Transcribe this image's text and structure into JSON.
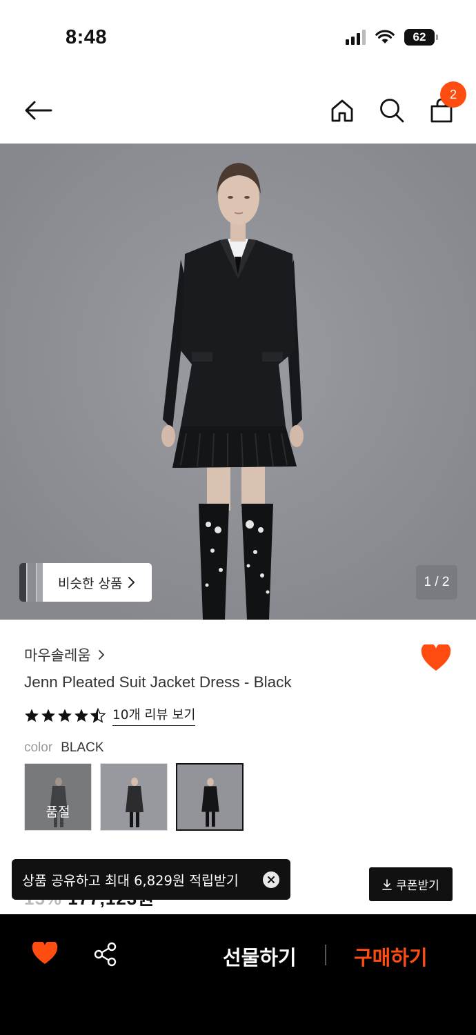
{
  "status_bar": {
    "time": "8:48",
    "battery": "62"
  },
  "nav": {
    "cart_count": "2"
  },
  "gallery": {
    "similar_label": "비슷한 상품",
    "page_indicator": "1 / 2"
  },
  "product": {
    "brand": "마우솔레움",
    "title": "Jenn Pleated Suit Jacket Dress - Black",
    "rating": 4.5,
    "review_link": "10개 리뷰 보기",
    "color_label": "color",
    "color_value": "BLACK",
    "swatches": [
      {
        "status": "품절"
      },
      {
        "status": ""
      },
      {
        "status": ""
      }
    ]
  },
  "price_peek": {
    "discount": "15%",
    "price": "177,123원"
  },
  "toast": {
    "message": "상품 공유하고 최대 6,829원 적립받기"
  },
  "coupon": {
    "label": "쿠폰받기"
  },
  "bottom_bar": {
    "gift_label": "선물하기",
    "buy_label": "구매하기"
  },
  "colors": {
    "accent": "#ff4d12",
    "dark": "#111111"
  }
}
